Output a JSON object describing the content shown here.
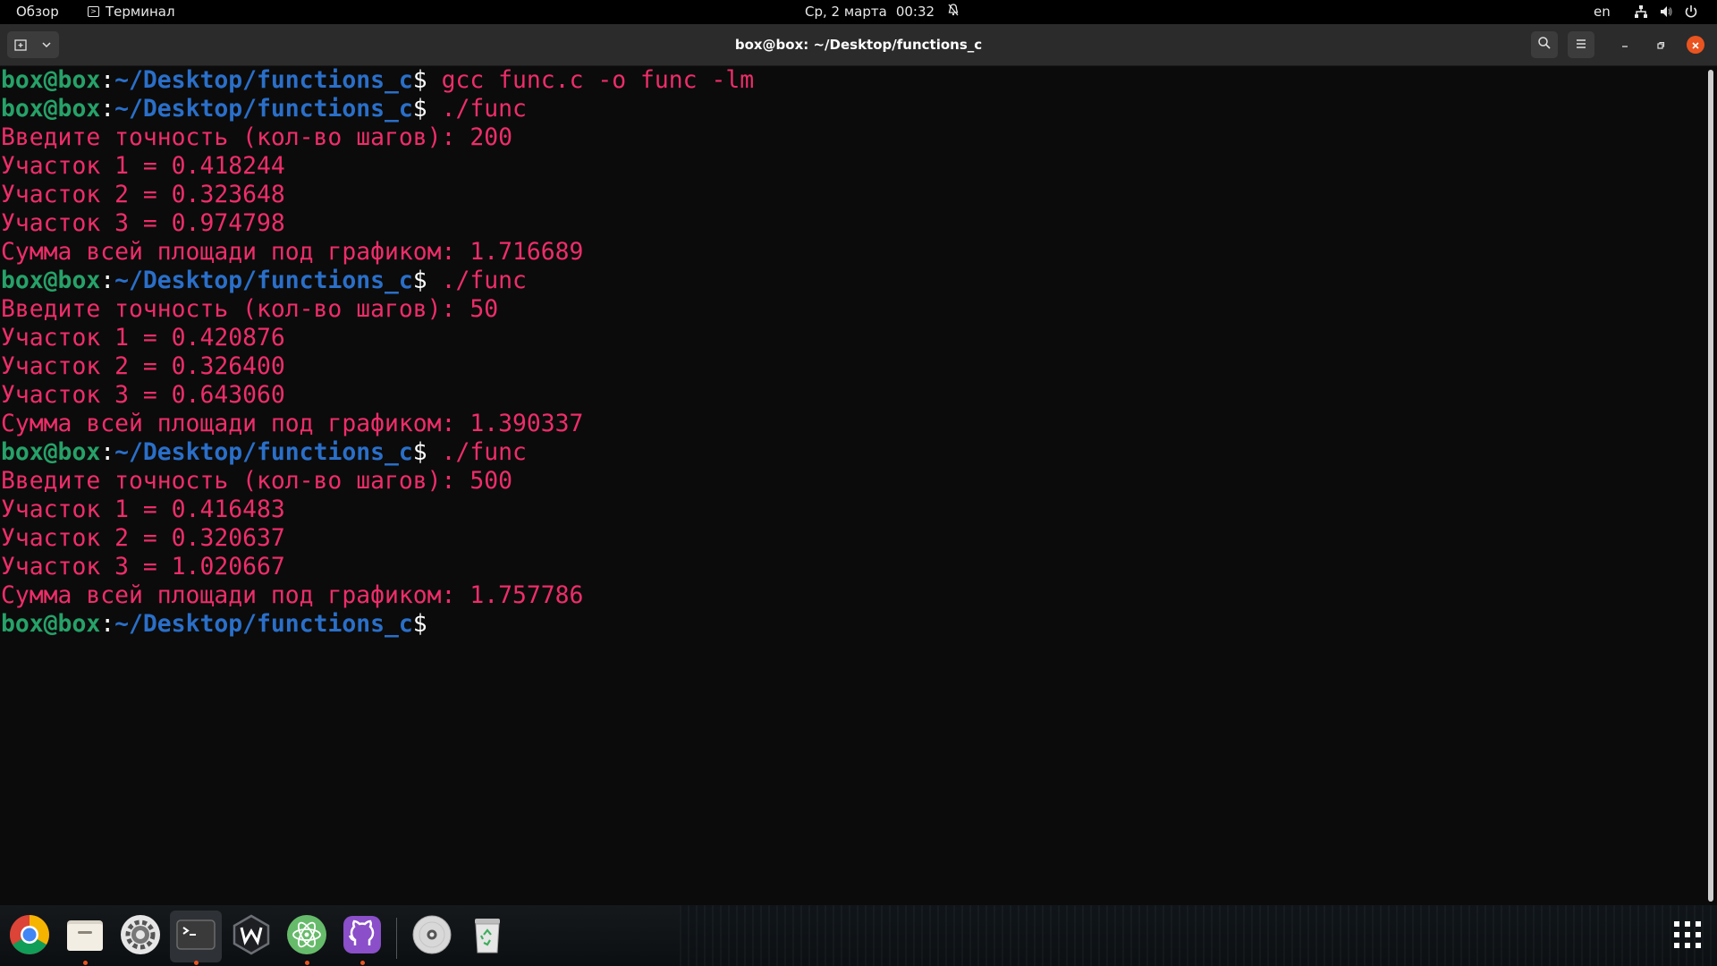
{
  "topbar": {
    "overview": "Обзор",
    "app_name": "Терминал",
    "date": "Ср, 2 марта",
    "time": "00:32",
    "lang": "en"
  },
  "window": {
    "title": "box@box: ~/Desktop/functions_c"
  },
  "terminal": {
    "user_host": "box@box",
    "colon": ":",
    "cwd": "~/Desktop/functions_c",
    "prompt_symbol": "$",
    "lines": [
      {
        "type": "prompt",
        "cmd": " gcc func.c -o func -lm"
      },
      {
        "type": "prompt",
        "cmd": " ./func"
      },
      {
        "type": "out",
        "text": "Введите точность (кол-во шагов): 200"
      },
      {
        "type": "out",
        "text": "Участок 1 = 0.418244"
      },
      {
        "type": "out",
        "text": "Участок 2 = 0.323648"
      },
      {
        "type": "out",
        "text": "Участок 3 = 0.974798"
      },
      {
        "type": "out",
        "text": "Сумма всей площади под графиком: 1.716689"
      },
      {
        "type": "prompt",
        "cmd": " ./func"
      },
      {
        "type": "out",
        "text": "Введите точность (кол-во шагов): 50"
      },
      {
        "type": "out",
        "text": "Участок 1 = 0.420876"
      },
      {
        "type": "out",
        "text": "Участок 2 = 0.326400"
      },
      {
        "type": "out",
        "text": "Участок 3 = 0.643060"
      },
      {
        "type": "out",
        "text": "Сумма всей площади под графиком: 1.390337"
      },
      {
        "type": "prompt",
        "cmd": " ./func"
      },
      {
        "type": "out",
        "text": "Введите точность (кол-во шагов): 500"
      },
      {
        "type": "out",
        "text": "Участок 1 = 0.416483"
      },
      {
        "type": "out",
        "text": "Участок 2 = 0.320637"
      },
      {
        "type": "out",
        "text": "Участок 3 = 1.020667"
      },
      {
        "type": "out",
        "text": "Сумма всей площади под графиком: 1.757786"
      },
      {
        "type": "prompt",
        "cmd": ""
      }
    ]
  },
  "dock": {
    "items": [
      {
        "name": "chrome-icon",
        "running": false
      },
      {
        "name": "files-icon",
        "running": true
      },
      {
        "name": "settings-icon",
        "running": false
      },
      {
        "name": "terminal-icon",
        "running": true
      },
      {
        "name": "webstorm-icon",
        "running": false
      },
      {
        "name": "atom-icon",
        "running": true
      },
      {
        "name": "github-desktop-icon",
        "running": true
      },
      {
        "name": "disc-icon",
        "running": false
      },
      {
        "name": "trash-icon",
        "running": false
      }
    ]
  },
  "colors": {
    "user_host": "#26a269",
    "path": "#2a6fc9",
    "text": "#ee2d6a",
    "close_button": "#e95420"
  }
}
